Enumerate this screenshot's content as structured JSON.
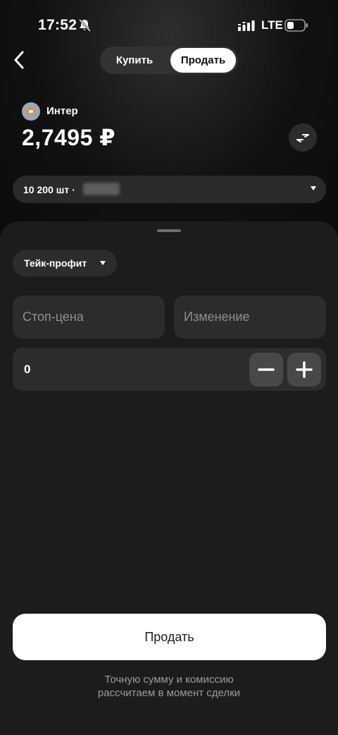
{
  "status_bar": {
    "time": "17:52",
    "network": "LTE"
  },
  "header": {
    "tabs": [
      "Купить",
      "Продать"
    ],
    "active_tab": "Продать"
  },
  "asset": {
    "name": "Интер",
    "price": "2,7495 ₽"
  },
  "quantity_selector": {
    "label": "10 200 шт ·"
  },
  "order_type": {
    "label": "Тейк-профит"
  },
  "fields": {
    "stop_price_placeholder": "Стоп-цена",
    "change_placeholder": "Изменение"
  },
  "quantity": {
    "value": "0"
  },
  "submit": {
    "label": "Продать"
  },
  "footer": {
    "note_line1": "Точную сумму и комиссию",
    "note_line2": "рассчитаем в момент сделки"
  }
}
